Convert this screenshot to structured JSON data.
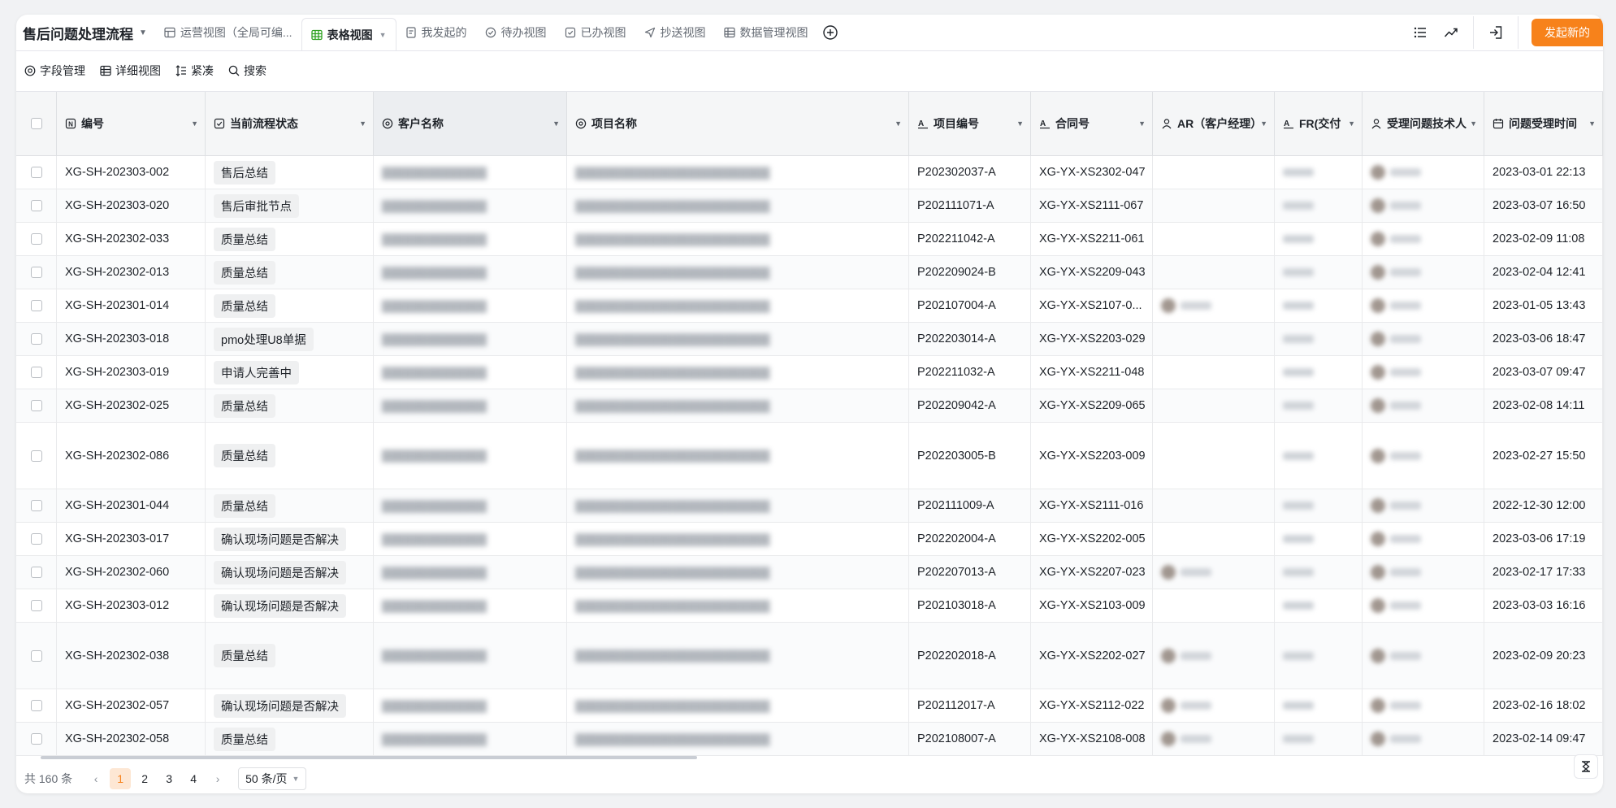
{
  "app": {
    "title": "售后问题处理流程"
  },
  "view_tabs": [
    {
      "label": "运营视图（全局可编...",
      "icon": "table-icon"
    },
    {
      "label": "表格视图",
      "icon": "table-icon-green",
      "active": true
    },
    {
      "label": "我发起的",
      "icon": "document-icon"
    },
    {
      "label": "待办视图",
      "icon": "check-circle-icon"
    },
    {
      "label": "已办视图",
      "icon": "check-square-icon"
    },
    {
      "label": "抄送视图",
      "icon": "send-icon"
    },
    {
      "label": "数据管理视图",
      "icon": "table-icon"
    }
  ],
  "actions": {
    "launch_label": "发起新的"
  },
  "toolbar": {
    "field_manage": "字段管理",
    "detail_view": "详细视图",
    "compact": "紧凑",
    "search": "搜索"
  },
  "columns": [
    {
      "label": "编号",
      "icon": "number-icon"
    },
    {
      "label": "当前流程状态",
      "icon": "status-icon"
    },
    {
      "label": "客户名称",
      "icon": "link-icon"
    },
    {
      "label": "项目名称",
      "icon": "link-icon"
    },
    {
      "label": "项目编号",
      "icon": "text-icon"
    },
    {
      "label": "合同号",
      "icon": "text-icon"
    },
    {
      "label": "AR（客户经理）",
      "icon": "person-icon"
    },
    {
      "label": "FR(交付",
      "icon": "text-icon"
    },
    {
      "label": "受理问题技术人",
      "icon": "person-icon"
    },
    {
      "label": "问题受理时间",
      "icon": "calendar-icon"
    }
  ],
  "rows": [
    {
      "id": "XG-SH-202303-002",
      "status": "售后总结",
      "project_no": "P202302037-A",
      "contract_no": "XG-YX-XS2302-047",
      "time": "2023-03-01 22:13"
    },
    {
      "id": "XG-SH-202303-020",
      "status": "售后审批节点",
      "project_no": "P202111071-A",
      "contract_no": "XG-YX-XS2111-067",
      "time": "2023-03-07 16:50"
    },
    {
      "id": "XG-SH-202302-033",
      "status": "质量总结",
      "project_no": "P202211042-A",
      "contract_no": "XG-YX-XS2211-061",
      "time": "2023-02-09 11:08"
    },
    {
      "id": "XG-SH-202302-013",
      "status": "质量总结",
      "project_no": "P202209024-B",
      "contract_no": "XG-YX-XS2209-043",
      "time": "2023-02-04 12:41"
    },
    {
      "id": "XG-SH-202301-014",
      "status": "质量总结",
      "project_no": "P202107004-A",
      "contract_no": "XG-YX-XS2107-0...",
      "time": "2023-01-05 13:43"
    },
    {
      "id": "XG-SH-202303-018",
      "status": "pmo处理U8单据",
      "project_no": "P202203014-A",
      "contract_no": "XG-YX-XS2203-029",
      "time": "2023-03-06 18:47"
    },
    {
      "id": "XG-SH-202303-019",
      "status": "申请人完善中",
      "project_no": "P202211032-A",
      "contract_no": "XG-YX-XS2211-048",
      "time": "2023-03-07 09:47"
    },
    {
      "id": "XG-SH-202302-025",
      "status": "质量总结",
      "project_no": "P202209042-A",
      "contract_no": "XG-YX-XS2209-065",
      "time": "2023-02-08 14:11"
    },
    {
      "id": "XG-SH-202302-086",
      "status": "质量总结",
      "project_no": "P202203005-B",
      "contract_no": "XG-YX-XS2203-009",
      "time": "2023-02-27 15:50"
    },
    {
      "id": "XG-SH-202301-044",
      "status": "质量总结",
      "project_no": "P202111009-A",
      "contract_no": "XG-YX-XS2111-016",
      "time": "2022-12-30 12:00"
    },
    {
      "id": "XG-SH-202303-017",
      "status": "确认现场问题是否解决",
      "project_no": "P202202004-A",
      "contract_no": "XG-YX-XS2202-005",
      "time": "2023-03-06 17:19"
    },
    {
      "id": "XG-SH-202302-060",
      "status": "确认现场问题是否解决",
      "project_no": "P202207013-A",
      "contract_no": "XG-YX-XS2207-023",
      "time": "2023-02-17 17:33"
    },
    {
      "id": "XG-SH-202303-012",
      "status": "确认现场问题是否解决",
      "project_no": "P202103018-A",
      "contract_no": "XG-YX-XS2103-009",
      "time": "2023-03-03 16:16"
    },
    {
      "id": "XG-SH-202302-038",
      "status": "质量总结",
      "project_no": "P202202018-A",
      "contract_no": "XG-YX-XS2202-027",
      "time": "2023-02-09 20:23"
    },
    {
      "id": "XG-SH-202302-057",
      "status": "确认现场问题是否解决",
      "project_no": "P202112017-A",
      "contract_no": "XG-YX-XS2112-022",
      "time": "2023-02-16 18:02"
    },
    {
      "id": "XG-SH-202302-058",
      "status": "质量总结",
      "project_no": "P202108007-A",
      "contract_no": "XG-YX-XS2108-008",
      "time": "2023-02-14 09:47"
    }
  ],
  "pagination": {
    "total_label": "共 160 条",
    "pages": [
      "1",
      "2",
      "3",
      "4"
    ],
    "current": "1",
    "page_size": "50 条/页"
  },
  "colors": {
    "accent": "#f7821b",
    "active_view_icon": "#2ea121"
  }
}
